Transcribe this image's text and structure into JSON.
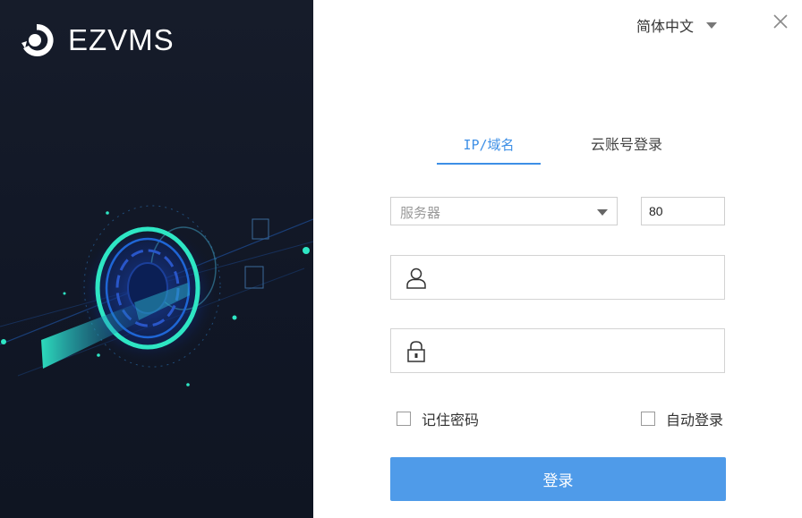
{
  "brand": {
    "name": "EZVMS"
  },
  "language": {
    "selected": "简体中文",
    "icon": "chevron-down-icon"
  },
  "window": {
    "close_icon": "close-icon"
  },
  "tabs": [
    {
      "label": "IP/域名",
      "active": true
    },
    {
      "label": "云账号登录",
      "active": false
    }
  ],
  "server": {
    "placeholder": "服务器",
    "value": ""
  },
  "port": {
    "value": "80"
  },
  "username": {
    "value": "",
    "icon": "user-icon"
  },
  "password": {
    "value": "",
    "icon": "lock-icon"
  },
  "options": {
    "remember_password": {
      "label": "记住密码",
      "checked": false
    },
    "auto_login": {
      "label": "自动登录",
      "checked": false
    }
  },
  "login_button": {
    "label": "登录"
  },
  "colors": {
    "accent": "#3d8fe6",
    "button": "#4f9be9",
    "left_panel": "#131a28",
    "ring_glow": "#2ee6c4"
  }
}
